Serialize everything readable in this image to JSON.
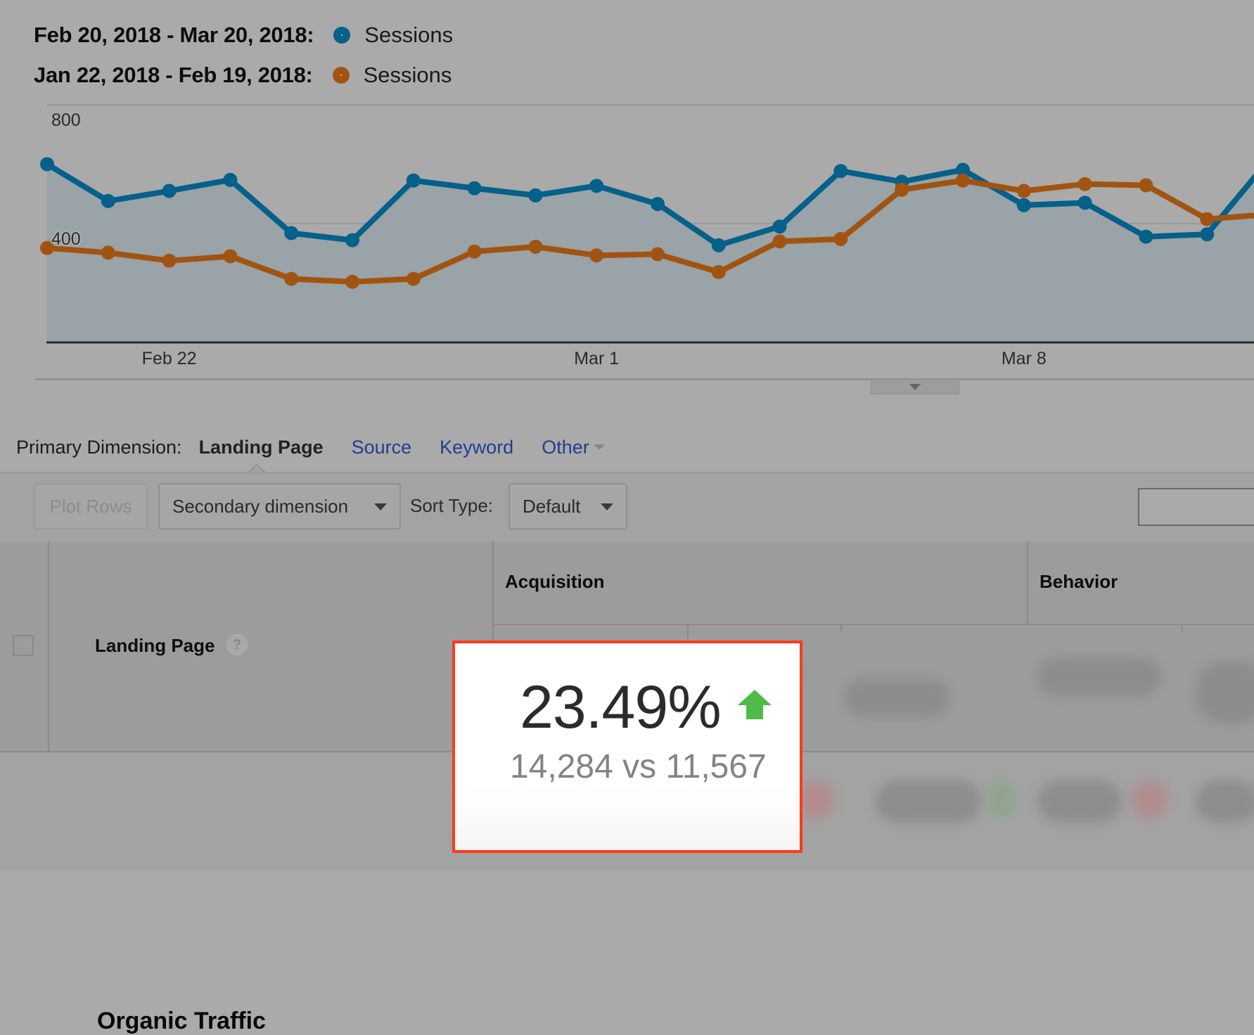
{
  "legend": [
    {
      "range": "Feb 20, 2018 - Mar 20, 2018:",
      "metric": "Sessions",
      "color": "#05608a"
    },
    {
      "range": "Jan 22, 2018 - Feb 19, 2018:",
      "metric": "Sessions",
      "color": "#a15412"
    }
  ],
  "chart_data": {
    "type": "line",
    "title": "",
    "xlabel": "",
    "ylabel": "Sessions",
    "ylim": [
      0,
      800
    ],
    "yticks": [
      "800",
      "400"
    ],
    "grid": true,
    "x_tick_labels": [
      {
        "label": "Feb 22",
        "index": 2
      },
      {
        "label": "Mar 1",
        "index": 9
      },
      {
        "label": "Mar 8",
        "index": 16
      }
    ],
    "x": [
      "Feb 20",
      "Feb 21",
      "Feb 22",
      "Feb 23",
      "Feb 24",
      "Feb 25",
      "Feb 26",
      "Feb 27",
      "Feb 28",
      "Mar 1",
      "Mar 2",
      "Mar 3",
      "Mar 4",
      "Mar 5",
      "Mar 6",
      "Mar 7",
      "Mar 8",
      "Mar 9",
      "Mar 10",
      "Mar 11",
      "Mar 12"
    ],
    "series": [
      {
        "name": "Sessions (Feb 20, 2018 - Mar 20, 2018)",
        "color": "#05608a",
        "filled": true,
        "values": [
          600,
          476,
          510,
          547,
          368,
          344,
          545,
          519,
          495,
          527,
          466,
          327,
          390,
          577,
          541,
          581,
          462,
          470,
          356,
          364,
          611
        ]
      },
      {
        "name": "Sessions (Jan 22, 2018 - Feb 19, 2018)",
        "color": "#a15412",
        "filled": false,
        "values": [
          318,
          302,
          275,
          290,
          214,
          204,
          214,
          306,
          322,
          293,
          297,
          237,
          340,
          348,
          514,
          545,
          510,
          533,
          529,
          415,
          431
        ]
      }
    ]
  },
  "primary_dimension": {
    "label": "Primary Dimension:",
    "active": "Landing Page",
    "links": [
      "Source",
      "Keyword"
    ],
    "other": "Other"
  },
  "toolbar": {
    "plot_rows": "Plot Rows",
    "secondary_dimension": "Secondary dimension",
    "sort_type_label": "Sort Type:",
    "sort_type_value": "Default",
    "search_value": ""
  },
  "table": {
    "col_landing_page": "Landing Page",
    "group_acquisition": "Acquisition",
    "group_behavior": "Behavior",
    "row_label": "Organic Traffic"
  },
  "highlight": {
    "percent_change": "23.49%",
    "direction": "up",
    "comparison": "14,284 vs 11,567",
    "arrow_color": "#4fbb48",
    "border_color": "#ff3a1a"
  }
}
